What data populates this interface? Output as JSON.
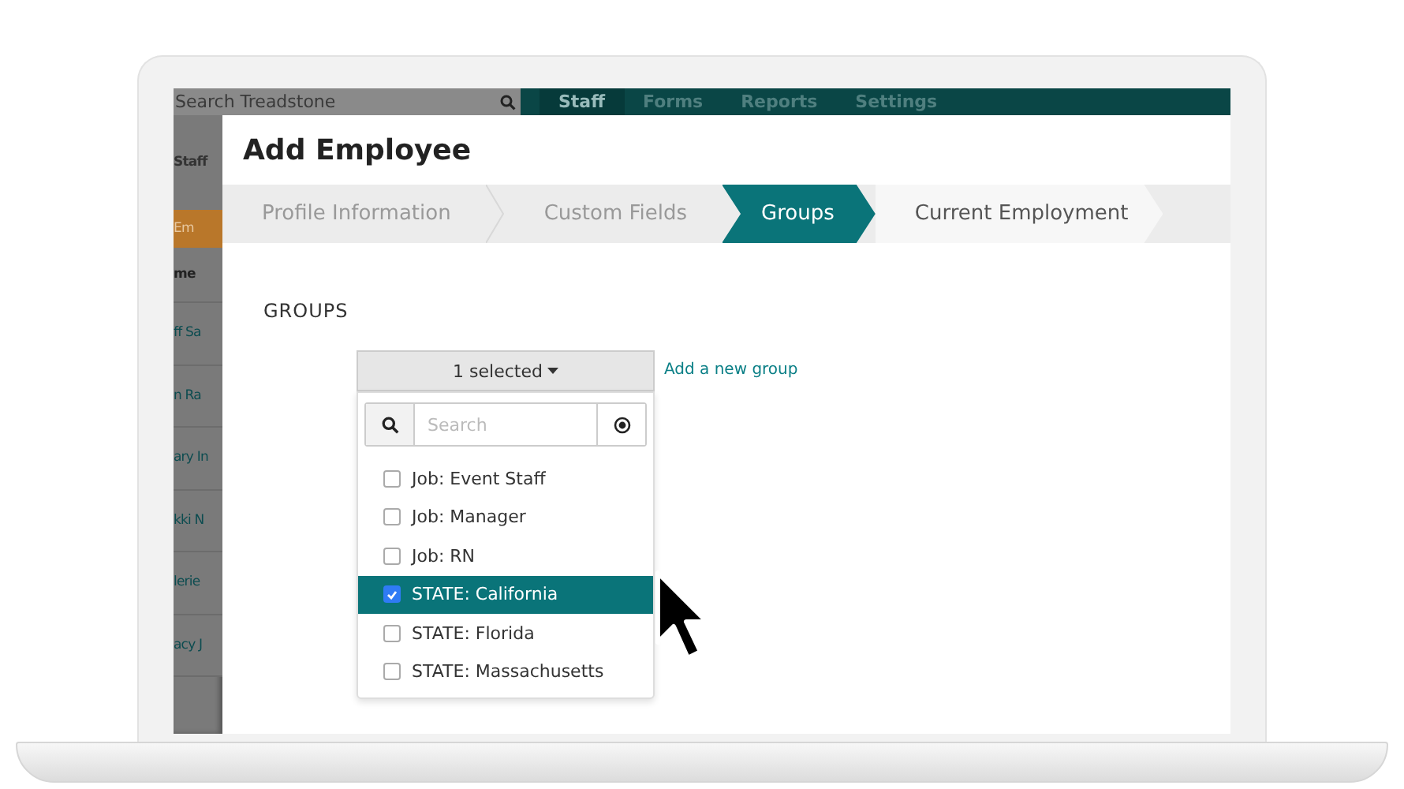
{
  "app": {
    "search": {
      "placeholder": "Search Treadstone"
    },
    "nav_tabs": [
      {
        "label": "Staff",
        "selected": true
      },
      {
        "label": "Forms",
        "selected": false
      },
      {
        "label": "Reports",
        "selected": false
      },
      {
        "label": "Settings",
        "selected": false
      }
    ],
    "sidebar_fragments": [
      {
        "text": "Staff",
        "kind": "heading"
      },
      {
        "text": "Em",
        "kind": "button"
      },
      {
        "text": "me",
        "kind": "header"
      },
      {
        "text": "ff Sa",
        "kind": "link"
      },
      {
        "text": "n Ra",
        "kind": "link"
      },
      {
        "text": "ary In",
        "kind": "link"
      },
      {
        "text": "kki N",
        "kind": "link"
      },
      {
        "text": "lerie",
        "kind": "link"
      },
      {
        "text": "acy J",
        "kind": "link"
      }
    ]
  },
  "modal": {
    "title": "Add Employee",
    "steps": [
      {
        "label": "Profile Information",
        "selected": false
      },
      {
        "label": "Custom Fields",
        "selected": false
      },
      {
        "label": "Groups",
        "selected": true
      },
      {
        "label": "Current Employment",
        "selected": false
      }
    ],
    "section_heading": "GROUPS",
    "dropdown": {
      "button_label": "1 selected",
      "expanded": true,
      "search": {
        "placeholder": "Search"
      },
      "items": [
        {
          "label": "Job: Event Staff",
          "checked": false,
          "selected": false
        },
        {
          "label": "Job: Manager",
          "checked": false,
          "selected": false
        },
        {
          "label": "Job: RN",
          "checked": false,
          "selected": false
        },
        {
          "label": "STATE: California",
          "checked": true,
          "selected": true
        },
        {
          "label": "STATE: Florida",
          "checked": false,
          "selected": false
        },
        {
          "label": "STATE: Massachusetts",
          "checked": false,
          "selected": false
        }
      ]
    },
    "add_link": "Add a new group"
  }
}
